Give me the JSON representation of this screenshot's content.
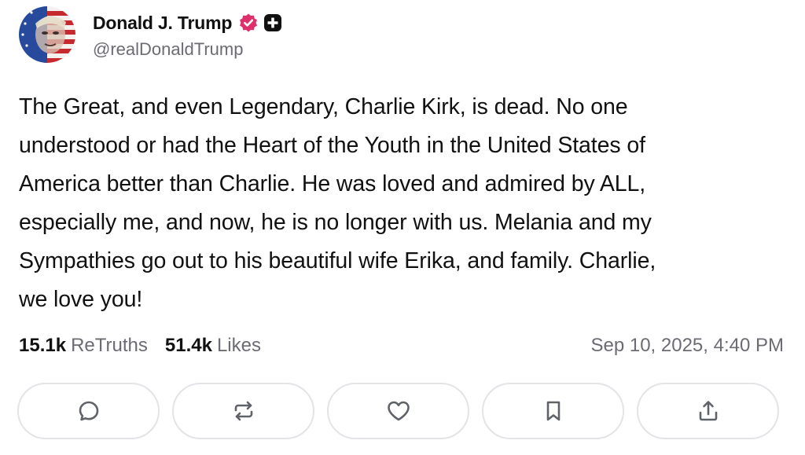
{
  "author": {
    "display_name": "Donald J. Trump",
    "handle": "@realDonaldTrump",
    "verified_icon": "verified-badge-icon",
    "extra_icon": "plus-badge-icon"
  },
  "post": {
    "text": "The Great, and even Legendary, Charlie Kirk, is dead. No one\nunderstood or had the Heart of the Youth in the United States of\nAmerica better than Charlie. He was loved and admired by ALL,\nespecially me, and now, he is no longer with us. Melania and my\nSympathies go out to his beautiful wife Erika, and family. Charlie,\nwe love you!",
    "timestamp": "Sep 10, 2025, 4:40 PM"
  },
  "stats": {
    "retruths_count": "15.1k",
    "retruths_label": "ReTruths",
    "likes_count": "51.4k",
    "likes_label": "Likes"
  },
  "actions": [
    {
      "name": "reply",
      "icon": "comment-icon"
    },
    {
      "name": "retruth",
      "icon": "repost-icon"
    },
    {
      "name": "like",
      "icon": "heart-icon"
    },
    {
      "name": "bookmark",
      "icon": "bookmark-icon"
    },
    {
      "name": "share",
      "icon": "share-icon"
    }
  ],
  "colors": {
    "text_primary": "#111111",
    "text_secondary": "#6b6b73",
    "verified_badge": "#e0306b",
    "button_border": "#e4e4e8",
    "icon": "#5f6268"
  }
}
